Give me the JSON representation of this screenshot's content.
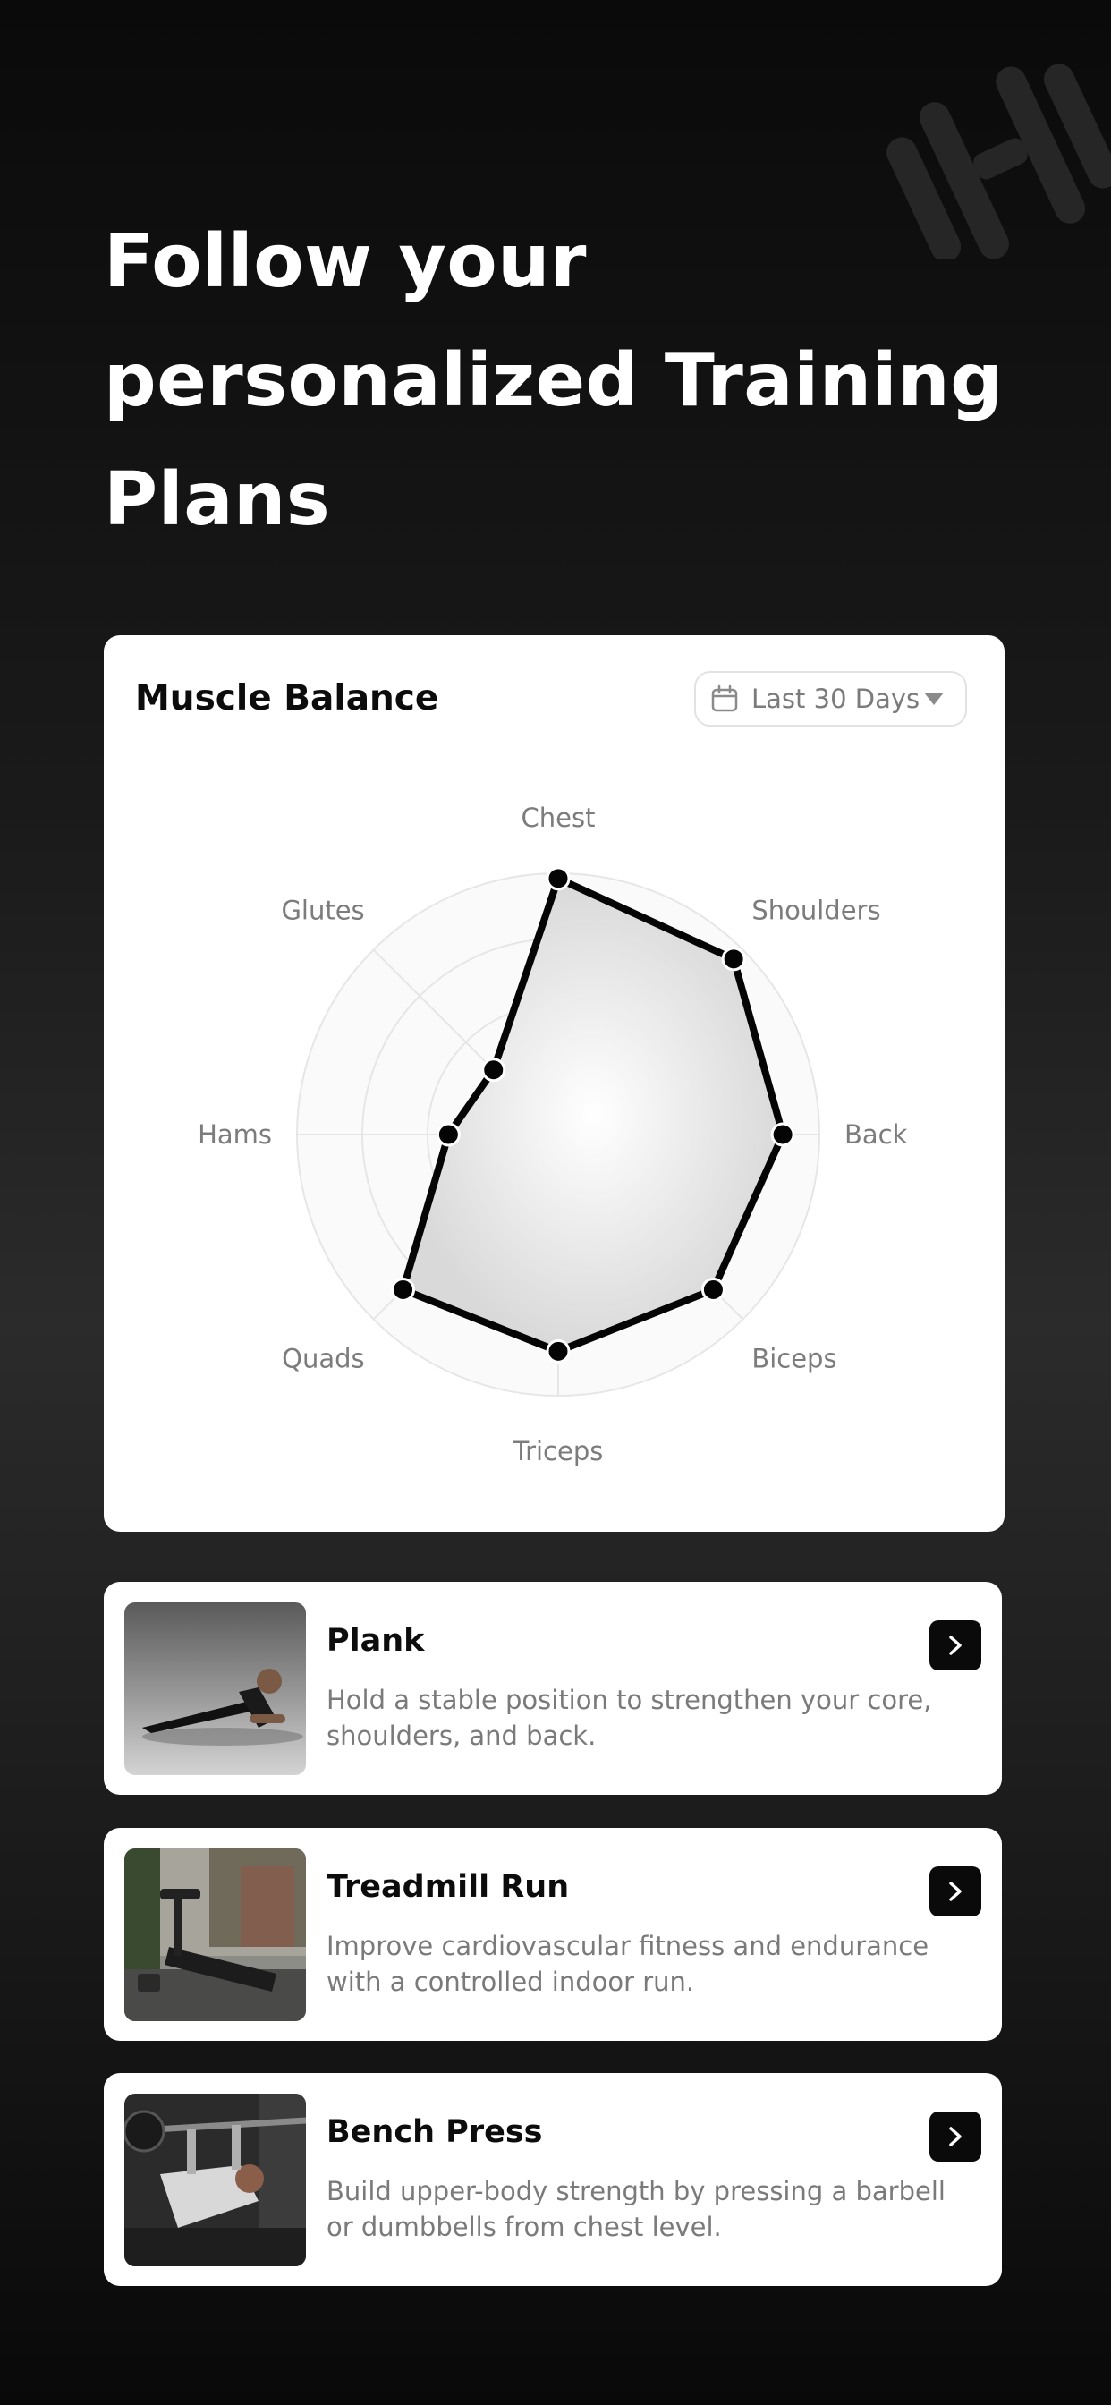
{
  "headline": {
    "line1": "Follow your",
    "line2": "personalized Training",
    "line3": "Plans"
  },
  "muscle_balance": {
    "title": "Muscle Balance",
    "range_select": {
      "value": "Last 30 Days",
      "icon": "calendar-icon",
      "caret": "caret-down-icon"
    }
  },
  "chart_data": {
    "type": "radar",
    "axes": [
      "Chest",
      "Shoulders",
      "Back",
      "Biceps",
      "Triceps",
      "Quads",
      "Hams",
      "Glutes"
    ],
    "values": [
      0.98,
      0.95,
      0.86,
      0.84,
      0.83,
      0.84,
      0.42,
      0.35
    ],
    "rlim": [
      0,
      1
    ],
    "rings": 4,
    "grid": true,
    "legend": "none"
  },
  "exercises": [
    {
      "title": "Plank",
      "description": "Hold a stable position to strengthen your core, shoulders, and back.",
      "action_icon": "chevron-right-icon"
    },
    {
      "title": "Treadmill Run",
      "description": "Improve cardiovascular fitness and endurance with a controlled indoor run.",
      "action_icon": "chevron-right-icon"
    },
    {
      "title": "Bench Press",
      "description": "Build upper-body strength by pressing a barbell or dumbbells from chest level.",
      "action_icon": "chevron-right-icon"
    }
  ],
  "colors": {
    "background_dark": "#0a0a0a",
    "card": "#ffffff",
    "accent": "#000000",
    "muted_text": "#7a7a7a"
  }
}
